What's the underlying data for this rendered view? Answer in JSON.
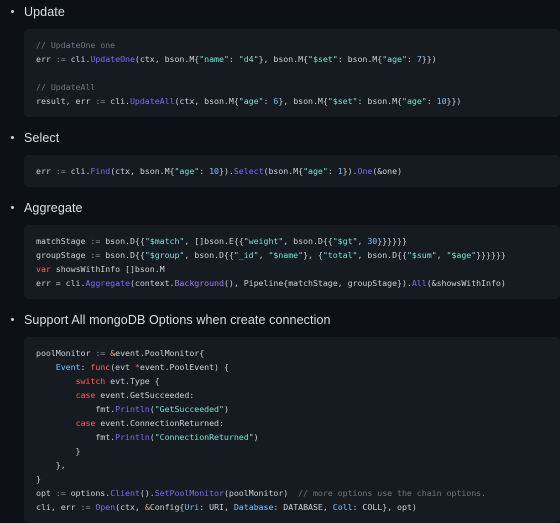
{
  "page": {
    "background": "#0d1117",
    "code_background": "#161b22",
    "text_color": "#c9d1d9"
  },
  "sections": [
    {
      "title": "Update",
      "code_lines": [
        "// UpdateOne one",
        "err := cli.UpdateOne(ctx, bson.M{\"name\": \"d4\"}, bson.M{\"$set\": bson.M{\"age\": 7}})",
        "",
        "// UpdateAll",
        "result, err := cli.UpdateAll(ctx, bson.M{\"age\": 6}, bson.M{\"$set\": bson.M{\"age\": 10}})"
      ]
    },
    {
      "title": "Select",
      "code_lines": [
        "err := cli.Find(ctx, bson.M{\"age\": 10}).Select(bson.M{\"age\": 1}).One(&one)"
      ]
    },
    {
      "title": "Aggregate",
      "code_lines": [
        "matchStage := bson.D{{\"$match\", []bson.E{{\"weight\", bson.D{{\"$gt\", 30}}}}}}",
        "groupStage := bson.D{{\"$group\", bson.D{{\"_id\", \"$name\"}, {\"total\", bson.D{{\"$sum\", \"$age\"}}}}}}",
        "var showsWithInfo []bson.M",
        "err = cli.Aggregate(context.Background(), Pipeline{matchStage, groupStage}).All(&showsWithInfo)"
      ]
    },
    {
      "title": "Support All mongoDB Options when create connection",
      "code_lines": [
        "poolMonitor := &event.PoolMonitor{",
        "    Event: func(evt *event.PoolEvent) {",
        "        switch evt.Type {",
        "        case event.GetSucceeded:",
        "            fmt.Println(\"GetSucceeded\")",
        "        case event.ConnectionReturned:",
        "            fmt.Println(\"ConnectionReturned\")",
        "        }",
        "    },",
        "}",
        "opt := options.Client().SetPoolMonitor(poolMonitor)  // more options use the chain options.",
        "cli, err := Open(ctx, &Config{Uri: URI, Database: DATABASE, Coll: COLL}, opt)"
      ]
    }
  ]
}
